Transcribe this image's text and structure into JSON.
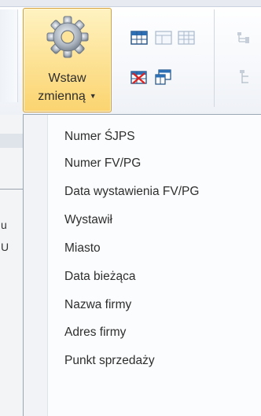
{
  "ribbon": {
    "insert_variable_button": {
      "label_line1": "Wstaw",
      "label_line2": "zmienną",
      "icon": "gear-icon",
      "has_dropdown": true
    },
    "small_icons": [
      "table-icon",
      "table-layout-icon",
      "table-grid-icon",
      "table-delete-icon",
      "table-properties-icon",
      "tree-structure-icon",
      "tree-branch-icon"
    ]
  },
  "dropdown": {
    "items": [
      "Numer ŚJPS",
      "Numer FV/PG",
      "Data wystawienia FV/PG",
      "Wystawił",
      "Miasto",
      "Data bieżąca",
      "Nazwa firmy",
      "Adres firmy",
      "Punkt sprzedaży"
    ]
  },
  "background": {
    "fragment1": "u",
    "fragment2": "U"
  },
  "colors": {
    "button_highlight": "#fde49a",
    "button_border": "#d5a03a",
    "menu_background": "#fbfcfd"
  }
}
